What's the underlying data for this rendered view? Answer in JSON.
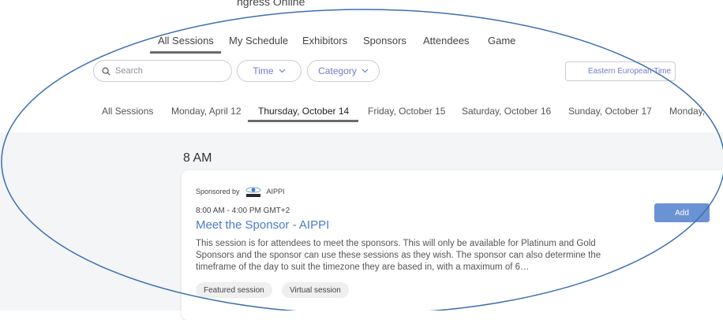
{
  "header": {
    "title_partial": "ngress Online"
  },
  "nav": {
    "tabs": [
      {
        "label": "All Sessions"
      },
      {
        "label": "My Schedule"
      },
      {
        "label": "Exhibitors"
      },
      {
        "label": "Sponsors"
      },
      {
        "label": "Attendees"
      },
      {
        "label": "Game"
      }
    ],
    "active_index": 0
  },
  "filters": {
    "search_placeholder": "Search",
    "time_label": "Time",
    "category_label": "Category",
    "timezone_label": "Eastern European Time"
  },
  "days": {
    "tabs": [
      {
        "label": "All Sessions"
      },
      {
        "label": "Monday, April 12"
      },
      {
        "label": "Thursday, October 14"
      },
      {
        "label": "Friday, October 15"
      },
      {
        "label": "Saturday, October 16"
      },
      {
        "label": "Sunday, October 17"
      },
      {
        "label": "Monday,"
      }
    ],
    "active_index": 2
  },
  "schedule": {
    "time_heading": "8 AM",
    "session": {
      "sponsored_by": "Sponsored by",
      "sponsor_name": "AIPPI",
      "time": "8:00 AM - 4:00 PM GMT+2",
      "title": "Meet the Sponsor - AIPPI",
      "description": "This session is for attendees to meet the sponsors. This will only be available for Platinum and Gold Sponsors and the sponsor can use these sessions as they wish. The sponsor can also determine the timeframe of the day to suit the timezone they are based in, with a maximum of 6…",
      "tags": [
        "Featured session",
        "Virtual session"
      ],
      "add_label": "Add"
    }
  },
  "colors": {
    "accent": "#4a7cc7",
    "add_button": "#6b93d4",
    "annotation_outline": "#3a6fb0"
  }
}
